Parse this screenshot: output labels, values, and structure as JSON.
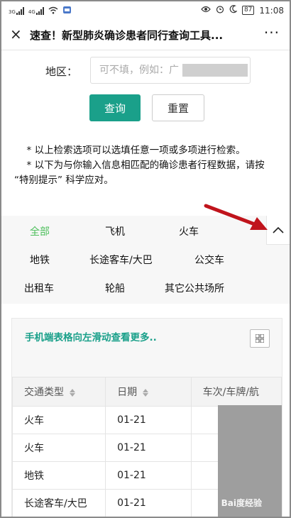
{
  "status": {
    "signal1": "3G",
    "signal2": "4G",
    "time": "11:08",
    "battery": "87"
  },
  "header": {
    "close": "×",
    "title": "速查！新型肺炎确诊患者同行查询工具...",
    "more": "···"
  },
  "form": {
    "label": "地区：",
    "placeholder": "可不填，例如：广",
    "query": "查询",
    "reset": "重置"
  },
  "notes": [
    "* 以上检索选项可以选填任意一项或多项进行检索。",
    "* 以下为与你输入信息相匹配的确诊患者行程数据，请按 “特别提示” 科学应对。"
  ],
  "categories": [
    "全部",
    "飞机",
    "火车",
    "地铁",
    "长途客车/大巴",
    "公交车",
    "出租车",
    "轮船",
    "其它公共场所"
  ],
  "table": {
    "hint": "手机端表格向左滑动查看更多..",
    "headers": [
      "交通类型",
      "日期",
      "车次/车牌/航"
    ],
    "rows": [
      [
        "火车",
        "01-21",
        ""
      ],
      [
        "火车",
        "01-21",
        ""
      ],
      [
        "地铁",
        "01-21",
        ""
      ],
      [
        "长途客车/大巴",
        "01-21",
        ""
      ]
    ]
  },
  "watermark": "Bai度经验",
  "colors": {
    "accent": "#1aa08a",
    "active_tab": "#4cbf5b",
    "annotation_arrow": "#c0141c"
  }
}
